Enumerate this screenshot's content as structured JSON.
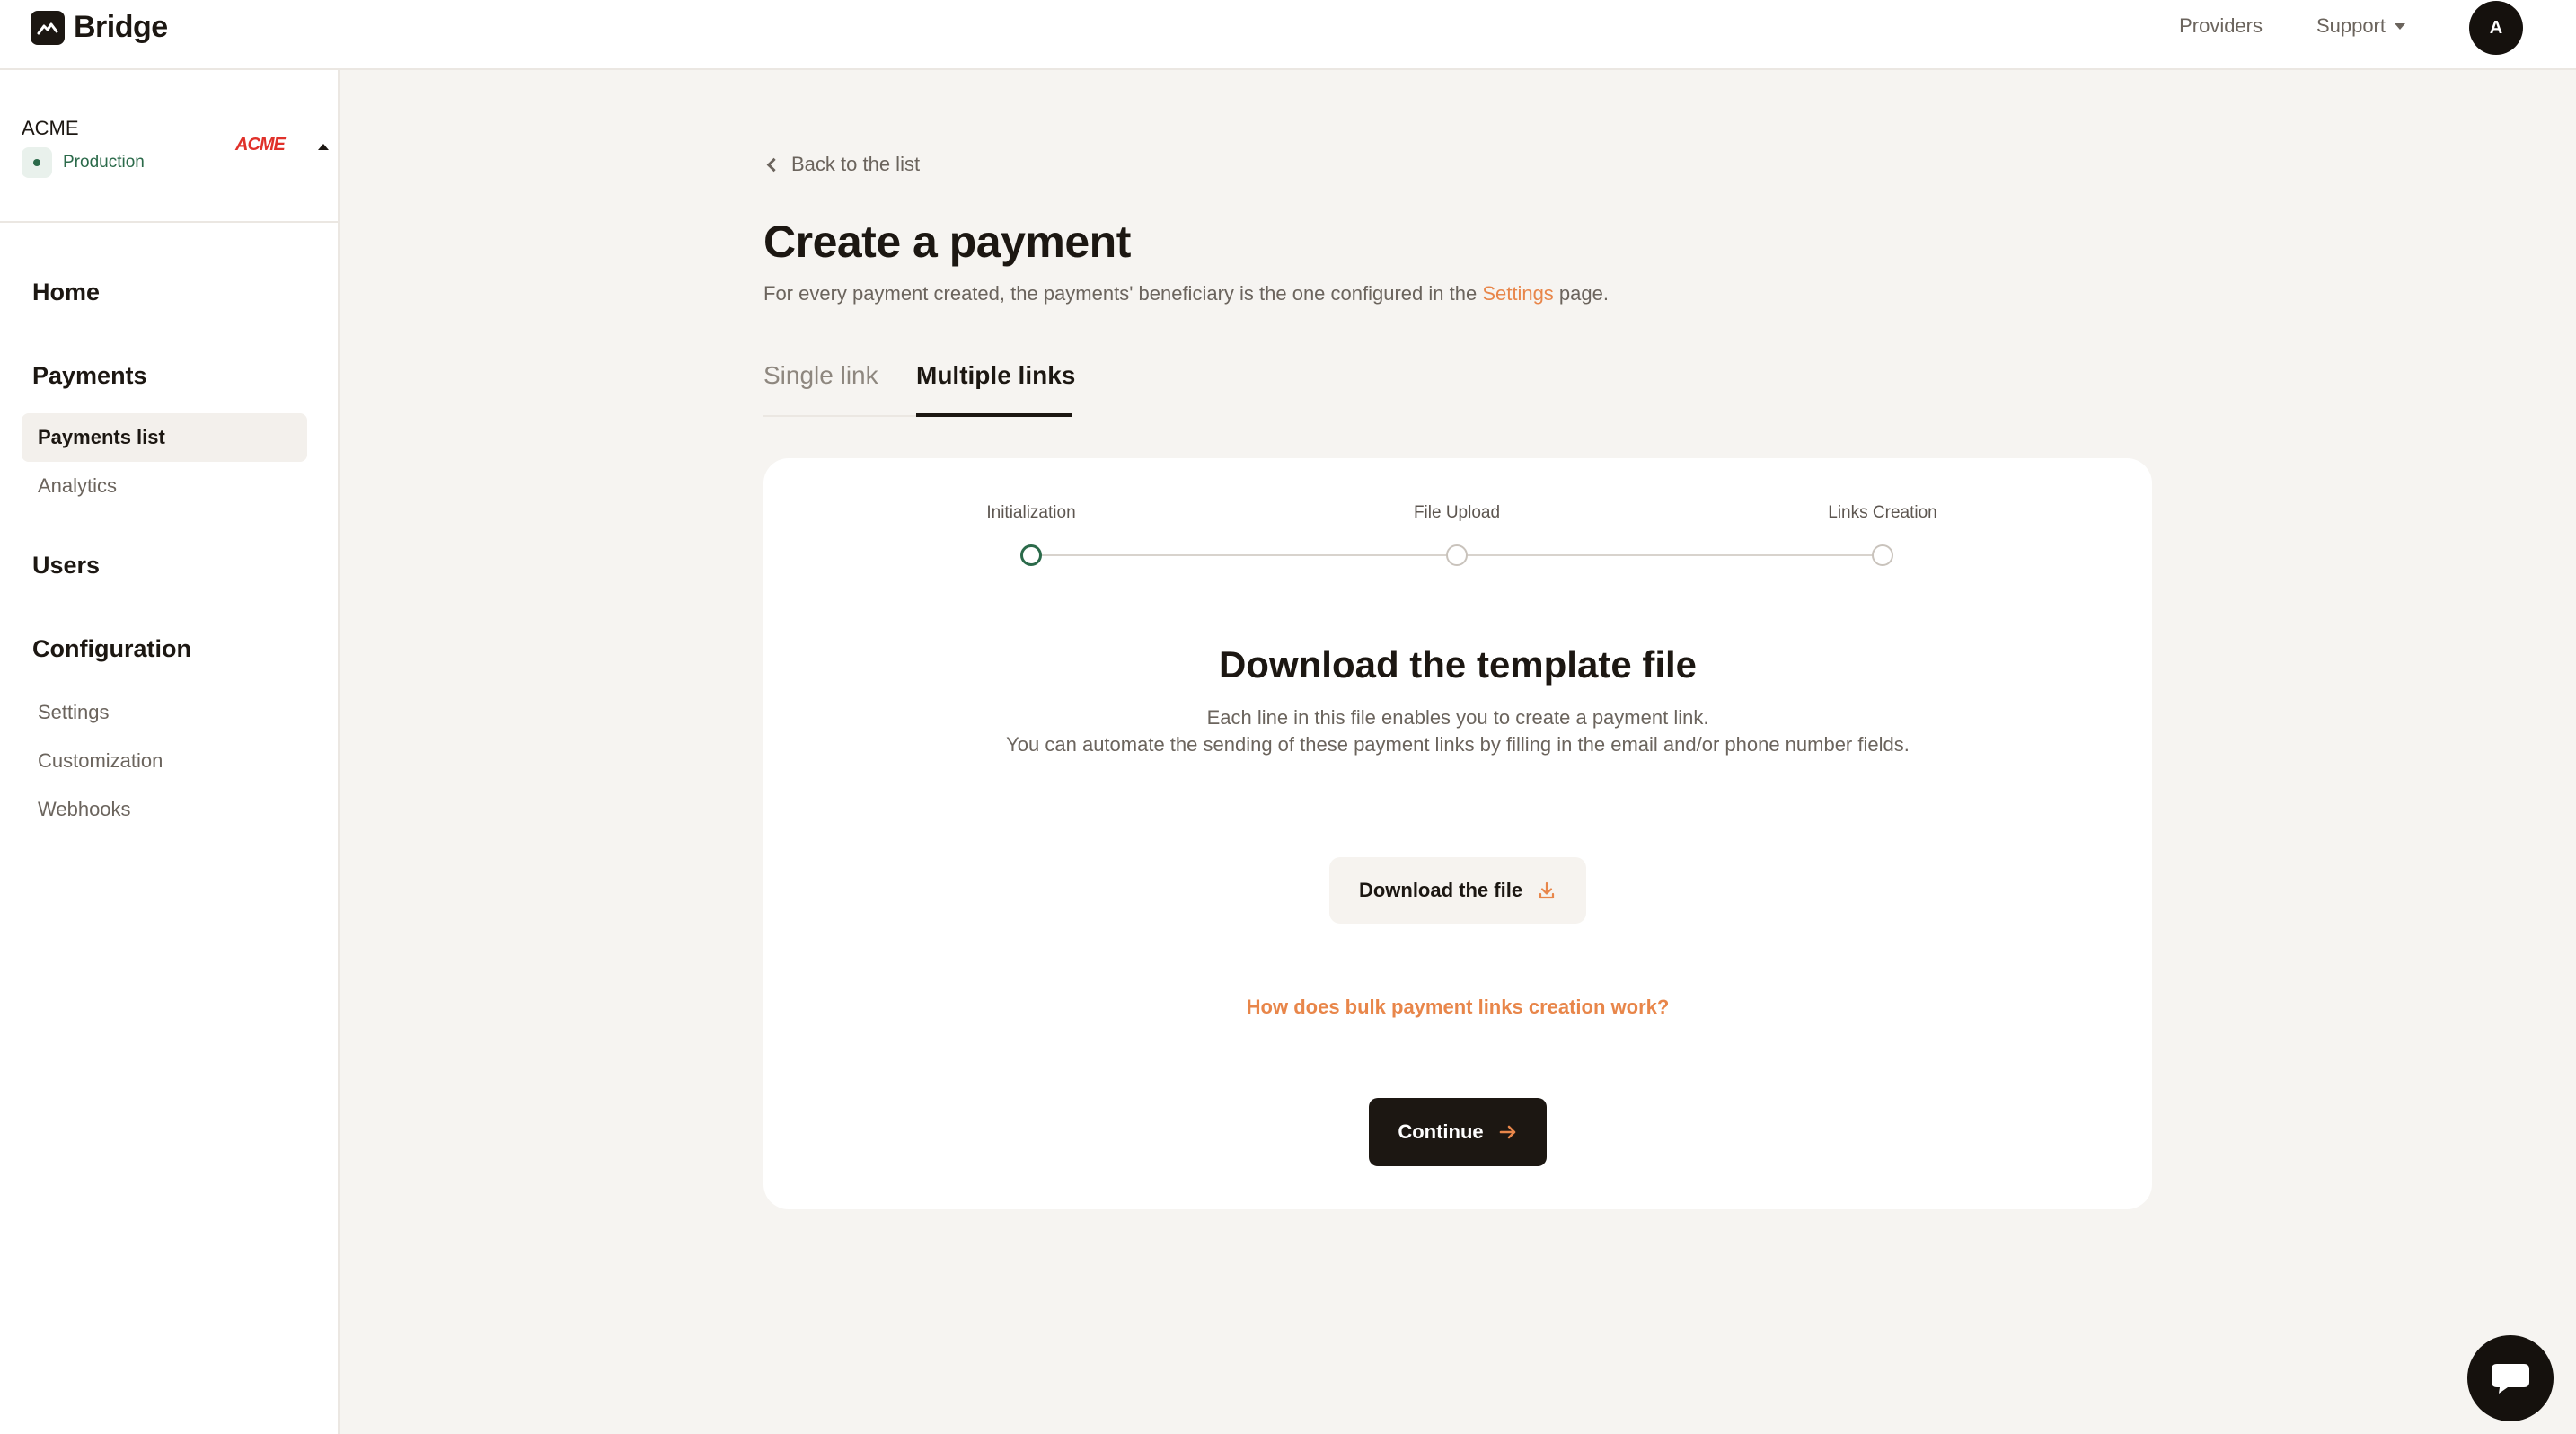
{
  "app": {
    "name": "Bridge"
  },
  "topnav": {
    "providers": "Providers",
    "support": "Support",
    "avatar_initial": "A"
  },
  "org": {
    "name": "ACME",
    "environment": "Production",
    "logo_text": "ACME"
  },
  "sidebar": {
    "home": "Home",
    "payments": "Payments",
    "payments_items": [
      "Payments list",
      "Analytics"
    ],
    "users": "Users",
    "configuration": "Configuration",
    "configuration_items": [
      "Settings",
      "Customization",
      "Webhooks"
    ]
  },
  "main": {
    "back_label": "Back to the list",
    "title": "Create a payment",
    "subtitle_before": "For every payment created, the payments' beneficiary is the one configured in the ",
    "subtitle_link": "Settings",
    "subtitle_after": " page.",
    "tabs": [
      {
        "label": "Single link",
        "active": false
      },
      {
        "label": "Multiple links",
        "active": true
      }
    ]
  },
  "stepper": {
    "steps": [
      {
        "label": "Initialization",
        "state": "current"
      },
      {
        "label": "File Upload",
        "state": "upcoming"
      },
      {
        "label": "Links Creation",
        "state": "upcoming"
      }
    ]
  },
  "card": {
    "title": "Download the template file",
    "desc_line1": "Each line in this file enables you to create a payment link.",
    "desc_line2": "You can automate the sending of these payment links by filling in the email and/or phone number fields.",
    "download_button": "Download the file",
    "help_link": "How does bulk payment links creation work?",
    "continue_button": "Continue"
  },
  "colors": {
    "accent": "#e8864a",
    "dark": "#1c1712",
    "success": "#2b6a4a",
    "background": "#f6f4f1"
  },
  "icons": [
    "bridge-logo-icon",
    "chevron-down-icon",
    "chevron-left-icon",
    "download-icon",
    "arrow-right-icon",
    "chat-icon"
  ]
}
